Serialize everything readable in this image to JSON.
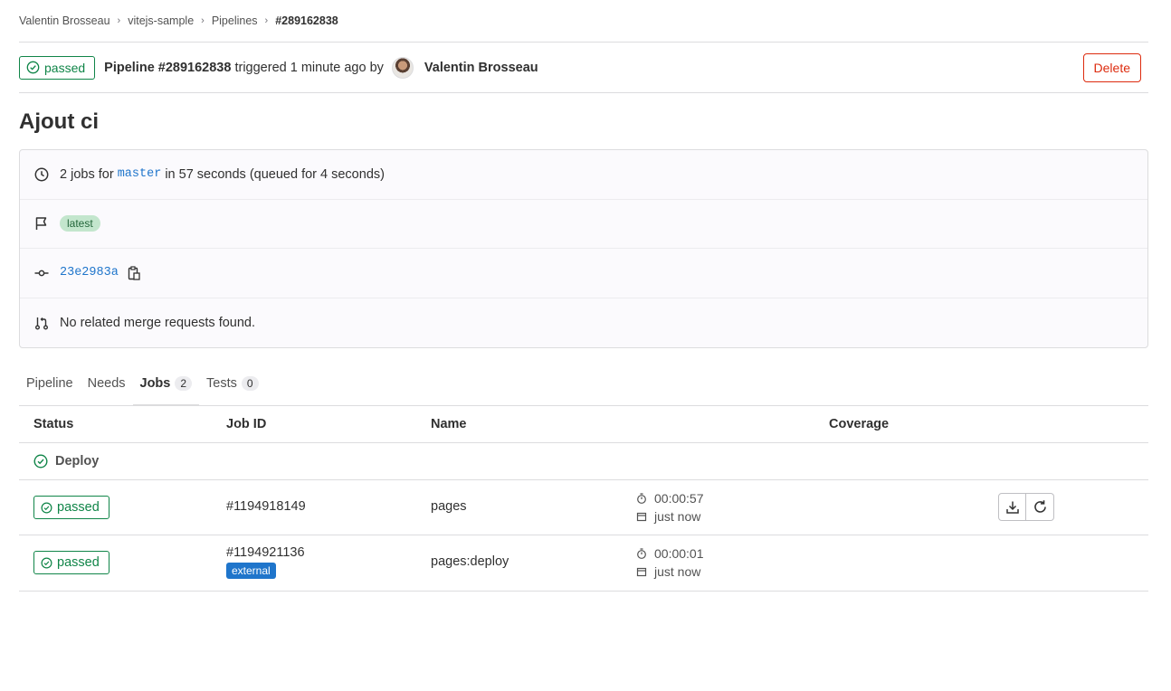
{
  "breadcrumb": [
    "Valentin Brosseau",
    "vitejs-sample",
    "Pipelines",
    "#289162838"
  ],
  "header": {
    "status": "passed",
    "pipeline_label": "Pipeline #289162838",
    "triggered_text": "triggered 1 minute ago by",
    "author": "Valentin Brosseau",
    "delete_label": "Delete"
  },
  "title": "Ajout ci",
  "info": {
    "jobs_prefix": "2 jobs for",
    "branch": "master",
    "jobs_suffix": "in 57 seconds (queued for 4 seconds)",
    "tag": "latest",
    "commit": "23e2983a",
    "merge_requests": "No related merge requests found."
  },
  "tabs": [
    {
      "label": "Pipeline",
      "count": null
    },
    {
      "label": "Needs",
      "count": null
    },
    {
      "label": "Jobs",
      "count": "2"
    },
    {
      "label": "Tests",
      "count": "0"
    }
  ],
  "table": {
    "headers": [
      "Status",
      "Job ID",
      "Name",
      "Coverage"
    ],
    "group": "Deploy",
    "rows": [
      {
        "status": "passed",
        "job_id": "#1194918149",
        "tag": "",
        "name": "pages",
        "duration": "00:00:57",
        "finished": "just now"
      },
      {
        "status": "passed",
        "job_id": "#1194921136",
        "tag": "external",
        "name": "pages:deploy",
        "duration": "00:00:01",
        "finished": "just now"
      }
    ]
  },
  "colors": {
    "success": "#108548",
    "danger": "#dd2b0e",
    "link": "#1f75cb"
  }
}
